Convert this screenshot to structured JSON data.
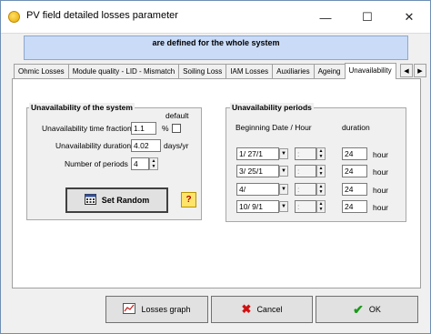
{
  "window": {
    "title": "PV field detailed losses parameter",
    "minimize_glyph": "—",
    "maximize_glyph": "☐",
    "close_glyph": "✕"
  },
  "banner": {
    "text": "are defined for the whole system"
  },
  "tabs": [
    {
      "label": "Ohmic Losses"
    },
    {
      "label": "Module quality - LID - Mismatch"
    },
    {
      "label": "Soiling Loss"
    },
    {
      "label": "IAM Losses"
    },
    {
      "label": "Auxiliaries"
    },
    {
      "label": "Ageing"
    },
    {
      "label": "Unavailability"
    }
  ],
  "tab_scroll": {
    "left": "◀",
    "right": "▶"
  },
  "unavailability_system": {
    "title": "Unavailability of the system",
    "default_label": "default",
    "fraction_label": "Unavailability time fraction",
    "fraction_value": "1.1",
    "fraction_unit": "%",
    "duration_label": "Unavailability duration",
    "duration_value": "4.02",
    "duration_unit": "days/yr",
    "periods_label": "Number of periods",
    "periods_value": "4",
    "set_random_label": "Set Random",
    "help_glyph": "?"
  },
  "unavailability_periods": {
    "title": "Unavailability periods",
    "begin_header": "Beginning Date / Hour",
    "duration_header": "duration",
    "rows": [
      {
        "date": "1/   27/1",
        "hour": ":",
        "duration": "24",
        "unit": "hour"
      },
      {
        "date": "3/   25/1",
        "hour": ":",
        "duration": "24",
        "unit": "hour"
      },
      {
        "date": "4/",
        "hour": ":",
        "duration": "24",
        "unit": "hour"
      },
      {
        "date": "10/   9/1",
        "hour": ":",
        "duration": "24",
        "unit": "hour"
      }
    ]
  },
  "footer": {
    "losses_graph_label": "Losses graph",
    "cancel_label": "Cancel",
    "ok_label": "OK"
  },
  "colors": {
    "banner_bg": "#c9dbf7",
    "cancel_icon": "#d01010",
    "ok_icon": "#1a9a1a"
  }
}
